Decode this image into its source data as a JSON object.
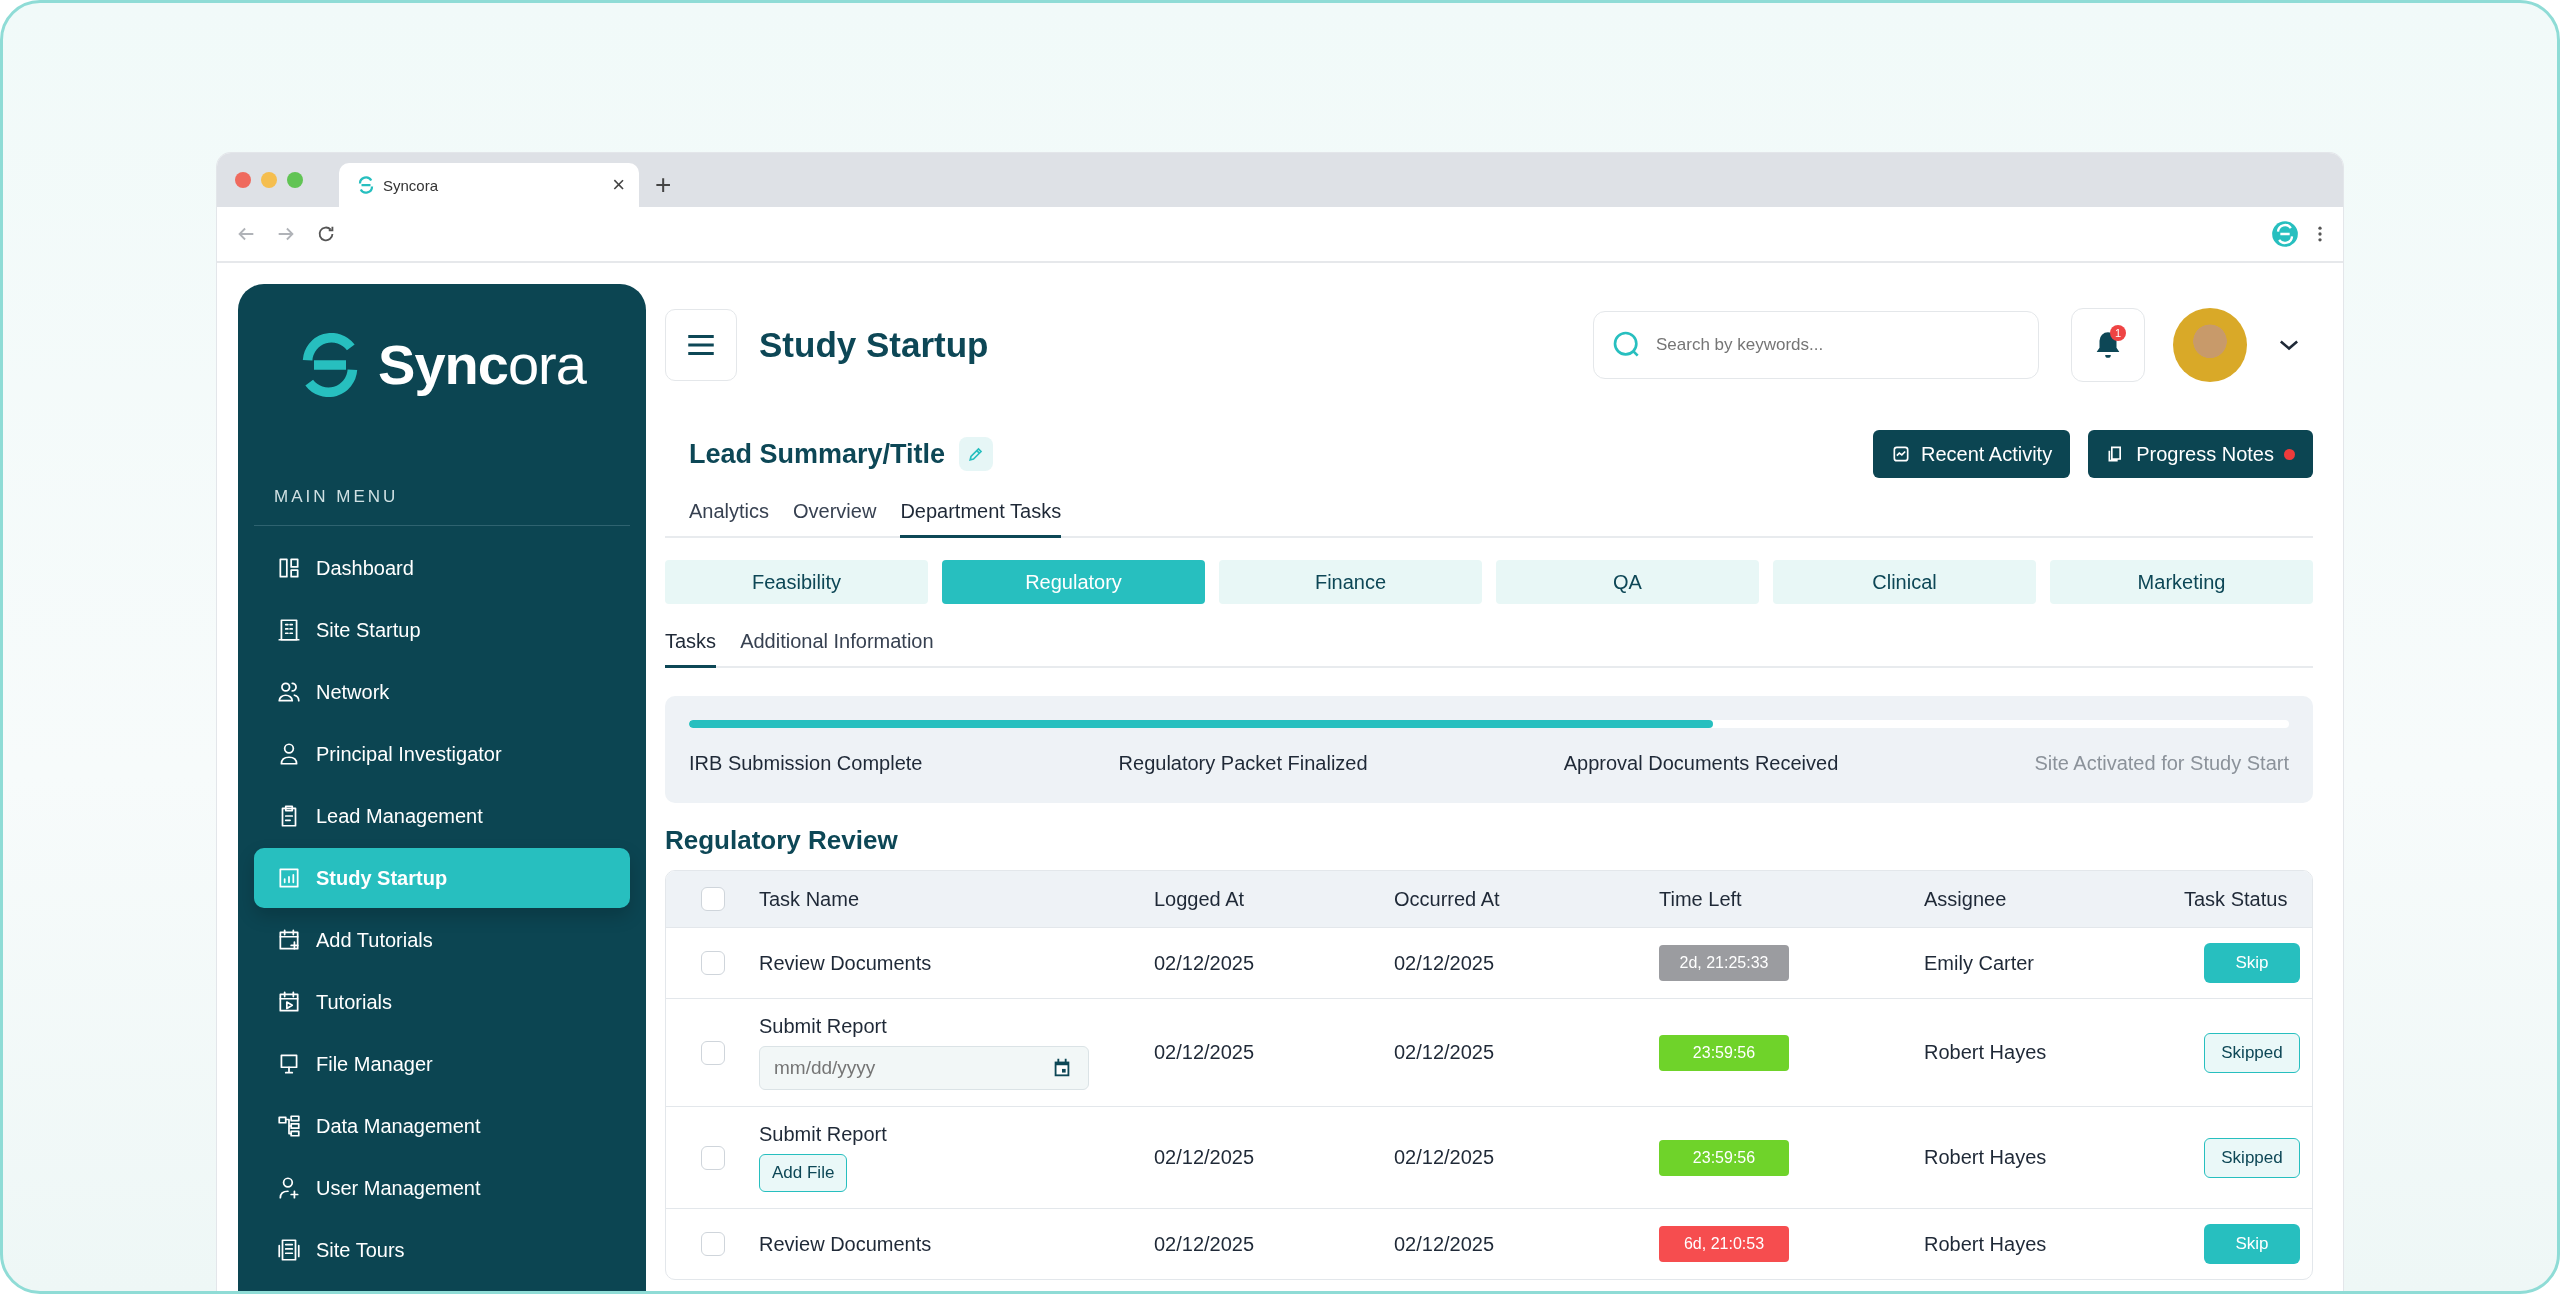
{
  "browser": {
    "tab_title": "Syncora",
    "tab_close": "×",
    "new_tab": "+"
  },
  "sidebar": {
    "logo": "**Sync**ora",
    "section_title": "MAIN MENU",
    "items": [
      {
        "label": "Dashboard",
        "selected": false
      },
      {
        "label": "Site Startup",
        "selected": false
      },
      {
        "label": "Network",
        "selected": false
      },
      {
        "label": "Principal Investigator",
        "selected": false
      },
      {
        "label": "Lead Management",
        "selected": false
      },
      {
        "label": "Study Startup",
        "selected": true
      },
      {
        "label": "Add Tutorials",
        "selected": false
      },
      {
        "label": "Tutorials",
        "selected": false
      },
      {
        "label": "File Manager",
        "selected": false
      },
      {
        "label": "Data Management",
        "selected": false
      },
      {
        "label": "User Management",
        "selected": false
      },
      {
        "label": "Site Tours",
        "selected": false
      }
    ]
  },
  "header": {
    "title": "Study Startup",
    "search": {
      "placeholder": "Search by keywords..."
    },
    "notification_count": "1"
  },
  "lead": {
    "title": "Lead Summary/Title",
    "actions": [
      {
        "label": "Recent Activity",
        "dot": false
      },
      {
        "label": "Progress Notes",
        "dot": true
      }
    ]
  },
  "tabs": [
    {
      "label": "Analytics",
      "selected": false
    },
    {
      "label": "Overview",
      "selected": false
    },
    {
      "label": "Department Tasks",
      "selected": true
    }
  ],
  "department_tabs": [
    {
      "label": "Feasibility",
      "selected": false
    },
    {
      "label": "Regulatory",
      "selected": true
    },
    {
      "label": "Finance",
      "selected": false
    },
    {
      "label": "QA",
      "selected": false
    },
    {
      "label": "Clinical",
      "selected": false
    },
    {
      "label": "Marketing",
      "selected": false
    }
  ],
  "sub_tabs": [
    {
      "label": "Tasks",
      "selected": true
    },
    {
      "label": "Additional Information",
      "selected": false
    }
  ],
  "progress": {
    "level": 0.64,
    "milestones": [
      {
        "label": "IRB Submission Complete",
        "reached": true
      },
      {
        "label": "Regulatory Packet Finalized",
        "reached": true
      },
      {
        "label": "Approval Documents Received",
        "reached": true
      },
      {
        "label": "Site Activated for Study Start",
        "reached": false
      }
    ]
  },
  "section_title": "Regulatory Review",
  "table": {
    "header_checked": false,
    "columns": [
      "Task Name",
      "Logged At",
      "Occurred At",
      "Time Left",
      "Assignee",
      "Task Status"
    ],
    "rows": [
      {
        "checked": false,
        "task_name": "Review Documents",
        "logged_at": "02/12/2025",
        "occurred_at": "02/12/2025",
        "time_left": {
          "text": "2d, 21:25:33",
          "color": "#9b9ca0"
        },
        "assignee": "Emily Carter",
        "status": {
          "label": "Skip",
          "kind": "action"
        }
      },
      {
        "checked": false,
        "task_name": "Submit Report",
        "extra": {
          "kind": "date",
          "placeholder": "mm/dd/yyyy"
        },
        "logged_at": "02/12/2025",
        "occurred_at": "02/12/2025",
        "time_left": {
          "text": "23:59:56",
          "color": "#6fd32a"
        },
        "assignee": "Robert Hayes",
        "status": {
          "label": "Skipped",
          "kind": "done"
        }
      },
      {
        "checked": false,
        "task_name": "Submit Report",
        "extra": {
          "kind": "file",
          "label": "Add File"
        },
        "logged_at": "02/12/2025",
        "occurred_at": "02/12/2025",
        "time_left": {
          "text": "23:59:56",
          "color": "#6fd32a"
        },
        "assignee": "Robert Hayes",
        "status": {
          "label": "Skipped",
          "kind": "done"
        }
      },
      {
        "checked": false,
        "task_name": "Review Documents",
        "logged_at": "02/12/2025",
        "occurred_at": "02/12/2025",
        "time_left": {
          "text": "6d, 21:0:53",
          "color": "#f64d4f"
        },
        "assignee": "Robert Hayes",
        "status": {
          "label": "Skip",
          "kind": "action"
        }
      }
    ]
  }
}
